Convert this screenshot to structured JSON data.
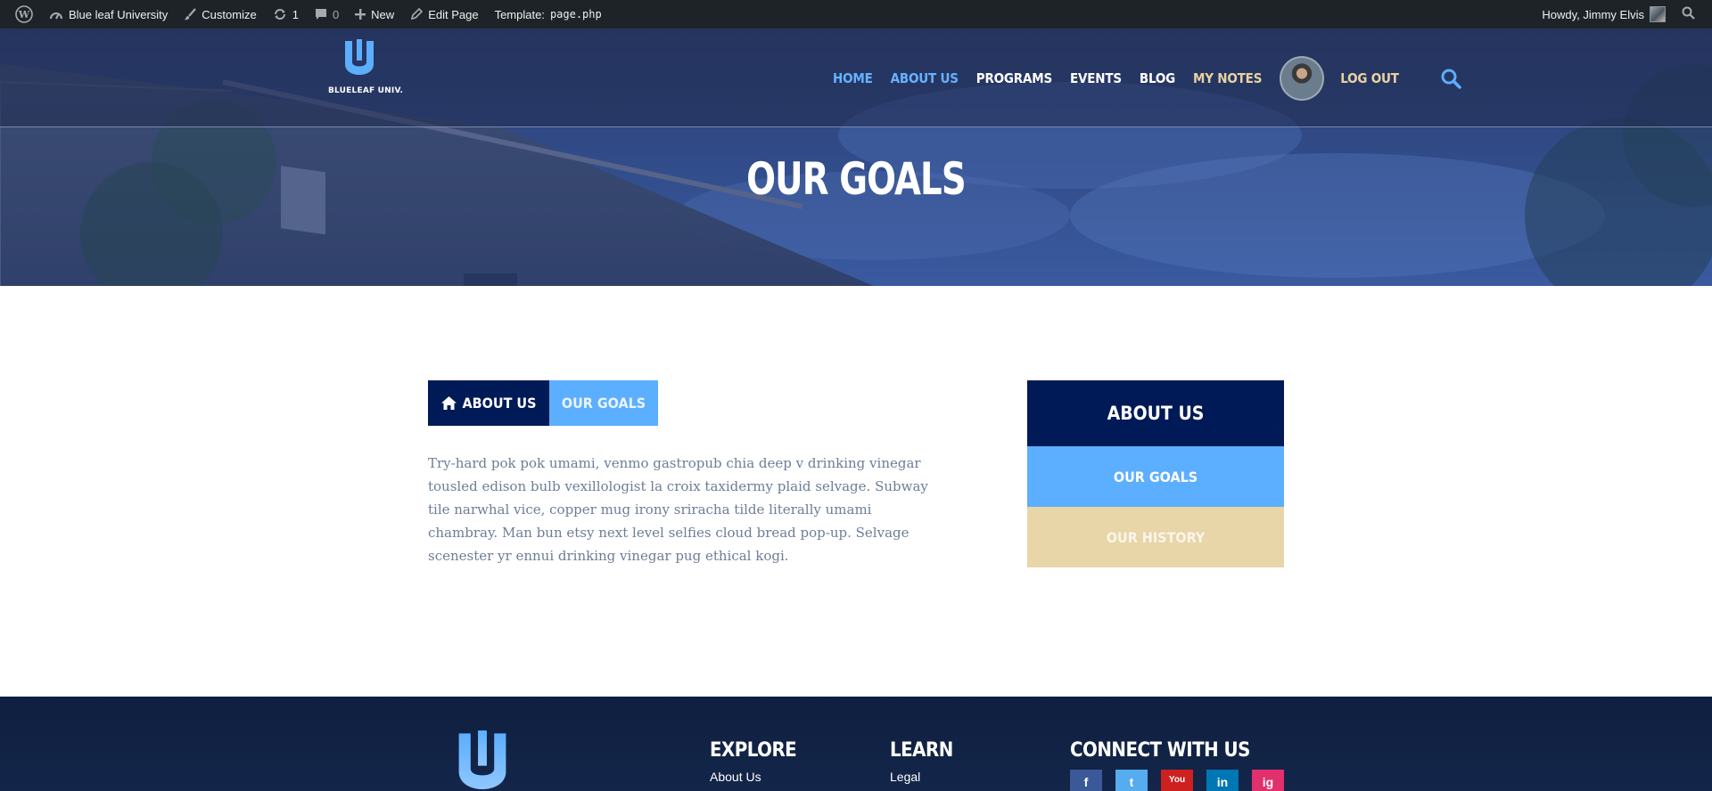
{
  "admin_bar": {
    "site_name": "Blue leaf University",
    "customize": "Customize",
    "updates_count": "1",
    "comments_count": "0",
    "new_label": "New",
    "edit_page": "Edit Page",
    "template_label": "Template:",
    "template_file": "page.php",
    "howdy": "Howdy, Jimmy Elvis"
  },
  "header": {
    "logo_text": "BLUELEAF UNIV.",
    "nav": [
      {
        "label": "HOME",
        "color": "#66b2ff"
      },
      {
        "label": "ABOUT US",
        "color": "#66b2ff"
      },
      {
        "label": "PROGRAMS",
        "color": "#ffffff"
      },
      {
        "label": "EVENTS",
        "color": "#ffffff"
      },
      {
        "label": "BLOG",
        "color": "#ffffff"
      },
      {
        "label": "MY NOTES",
        "color": "#e8d2a0"
      },
      {
        "label": "LOG OUT",
        "color": "#e8d2a0"
      }
    ]
  },
  "hero": {
    "title": "OUR GOALS"
  },
  "breadcrumb": {
    "parent": "ABOUT US",
    "current": "OUR GOALS"
  },
  "content": {
    "body": "Try-hard pok pok umami, venmo gastropub chia deep v drinking vinegar tousled edison bulb vexillologist la croix taxidermy plaid selvage. Subway tile narwhal vice, copper mug irony sriracha tilde literally umami chambray. Man bun etsy next level selfies cloud bread pop-up. Selvage scenester yr ennui drinking vinegar pug ethical kogi."
  },
  "side_nav": {
    "title": "ABOUT US",
    "items": [
      "OUR GOALS",
      "OUR HISTORY"
    ]
  },
  "footer": {
    "explore": {
      "heading": "EXPLORE",
      "first_link": "About Us"
    },
    "learn": {
      "heading": "LEARN",
      "first_link": "Legal"
    },
    "connect": {
      "heading": "CONNECT WITH US"
    },
    "social": [
      {
        "name": "facebook",
        "glyph": "f",
        "color": "#3b5998"
      },
      {
        "name": "twitter",
        "glyph": "t",
        "color": "#55acee"
      },
      {
        "name": "youtube",
        "glyph": "You",
        "color": "#cd201f"
      },
      {
        "name": "linkedin",
        "glyph": "in",
        "color": "#0077b5"
      },
      {
        "name": "instagram",
        "glyph": "ig",
        "color": "#e1306c"
      }
    ]
  },
  "colors": {
    "navy": "#001a57",
    "sky": "#5caeff",
    "sand": "#e8d5a8",
    "admin_bar": "#1d2327"
  }
}
